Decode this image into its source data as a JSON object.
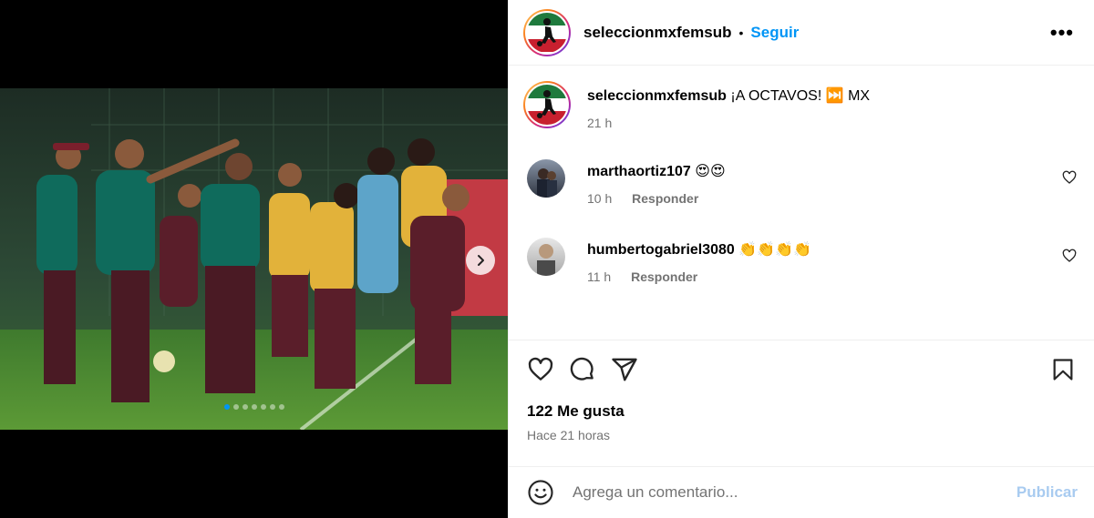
{
  "post": {
    "author": "seleccionmxfemsub",
    "separator": "•",
    "follow_label": "Seguir",
    "more_label": "•••",
    "image_index": 1,
    "image_count": 7
  },
  "caption": {
    "username": "seleccionmxfemsub",
    "text": "¡A OCTAVOS! ⏭️ MX",
    "time": "21 h"
  },
  "comments": [
    {
      "username": "marthaortiz107",
      "text": "😍😍",
      "time": "10 h",
      "reply_label": "Responder"
    },
    {
      "username": "humbertogabriel3080",
      "text": "👏👏👏👏",
      "time": "11 h",
      "reply_label": "Responder"
    }
  ],
  "engagement": {
    "likes": "122 Me gusta",
    "posted_ago": "Hace 21 horas"
  },
  "composer": {
    "placeholder": "Agrega un comentario...",
    "publish_label": "Publicar"
  },
  "icons": {
    "more": "more-options-icon",
    "like": "heart-icon",
    "comment": "comment-bubble-icon",
    "share": "paper-plane-icon",
    "save": "bookmark-icon",
    "emoji": "emoji-smiley-icon",
    "next": "chevron-right-icon"
  },
  "colors": {
    "accent": "#0095f6",
    "muted": "#737373",
    "publish_disabled": "#a8cbf0"
  }
}
